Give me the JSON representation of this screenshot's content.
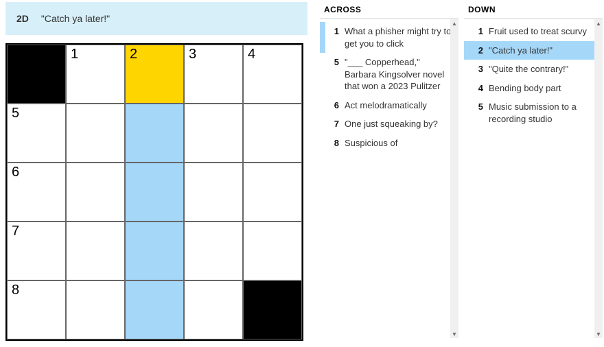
{
  "current_clue": {
    "label": "2D",
    "text": "\"Catch ya later!\""
  },
  "grid": {
    "rows": 5,
    "cols": 5,
    "cells": [
      [
        {
          "black": true
        },
        {
          "num": "1"
        },
        {
          "num": "2",
          "selected": true
        },
        {
          "num": "3"
        },
        {
          "num": "4"
        }
      ],
      [
        {
          "num": "5"
        },
        {},
        {
          "highlight": true
        },
        {},
        {}
      ],
      [
        {
          "num": "6"
        },
        {},
        {
          "highlight": true
        },
        {},
        {}
      ],
      [
        {
          "num": "7"
        },
        {},
        {
          "highlight": true
        },
        {},
        {}
      ],
      [
        {
          "num": "8"
        },
        {},
        {
          "highlight": true
        },
        {},
        {
          "black": true
        }
      ]
    ]
  },
  "across": {
    "title": "ACROSS",
    "clues": [
      {
        "num": "1",
        "text": "What a phisher might try to get you to click",
        "related": true
      },
      {
        "num": "5",
        "text": "\"___ Copperhead,\" Barbara Kingsolver novel that won a 2023 Pulitzer"
      },
      {
        "num": "6",
        "text": "Act melodramatically"
      },
      {
        "num": "7",
        "text": "One just squeaking by?"
      },
      {
        "num": "8",
        "text": "Suspicious of"
      }
    ]
  },
  "down": {
    "title": "DOWN",
    "clues": [
      {
        "num": "1",
        "text": "Fruit used to treat scurvy"
      },
      {
        "num": "2",
        "text": "\"Catch ya later!\"",
        "active": true
      },
      {
        "num": "3",
        "text": "\"Quite the contrary!\""
      },
      {
        "num": "4",
        "text": "Bending body part"
      },
      {
        "num": "5",
        "text": "Music submission to a recording studio"
      }
    ]
  },
  "scroll_glyphs": {
    "up": "▲",
    "down": "▼"
  }
}
